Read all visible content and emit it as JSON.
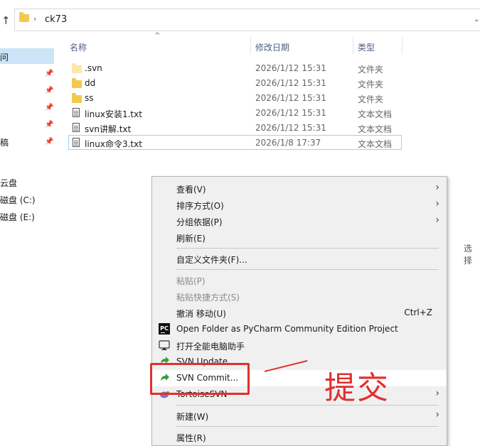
{
  "address": {
    "path": "ck73",
    "up_icon": "up-arrow-icon",
    "drop_icon": "chevron-down-icon"
  },
  "nav": {
    "items": [
      "问",
      "",
      "",
      "",
      "",
      "稿",
      "",
      "云盘",
      "磁盘 (C:)",
      "磁盘 (E:)"
    ],
    "pinned_icon": "pin-icon"
  },
  "columns": {
    "name": "名称",
    "date": "修改日期",
    "type": "类型"
  },
  "files": [
    {
      "name": ".svn",
      "date": "2026/1/12 15:31",
      "type": "文件夹",
      "icon": "folder-hidden-icon"
    },
    {
      "name": "dd",
      "date": "2026/1/12 15:31",
      "type": "文件夹",
      "icon": "folder-icon"
    },
    {
      "name": "ss",
      "date": "2026/1/12 15:31",
      "type": "文件夹",
      "icon": "folder-icon"
    },
    {
      "name": "linux安装1.txt",
      "date": "2026/1/12 15:31",
      "type": "文本文档",
      "icon": "text-file-icon"
    },
    {
      "name": "svn讲解.txt",
      "date": "2026/1/12 15:31",
      "type": "文本文档",
      "icon": "text-file-icon"
    },
    {
      "name": "linux命令3.txt",
      "date": "2026/1/8 17:37",
      "type": "文本文档",
      "icon": "text-file-icon"
    }
  ],
  "right_edge_text": "选择",
  "menu": {
    "view": "查看(V)",
    "sort": "排序方式(O)",
    "group": "分组依据(P)",
    "refresh": "刷新(E)",
    "customize": "自定义文件夹(F)...",
    "paste": "粘贴(P)",
    "paste_shortcut": "粘贴快捷方式(S)",
    "undo": "撤消 移动(U)",
    "undo_accel": "Ctrl+Z",
    "pycharm": "Open Folder as PyCharm Community Edition Project",
    "pycharm_icon_text": "PC",
    "assistant": "打开全能电脑助手",
    "svn_update": "SVN Update",
    "svn_commit": "SVN Commit...",
    "tortoise": "TortoiseSVN",
    "new": "新建(W)",
    "properties": "属性(R)"
  },
  "annotation": {
    "text": "提交",
    "color": "#e03030"
  }
}
